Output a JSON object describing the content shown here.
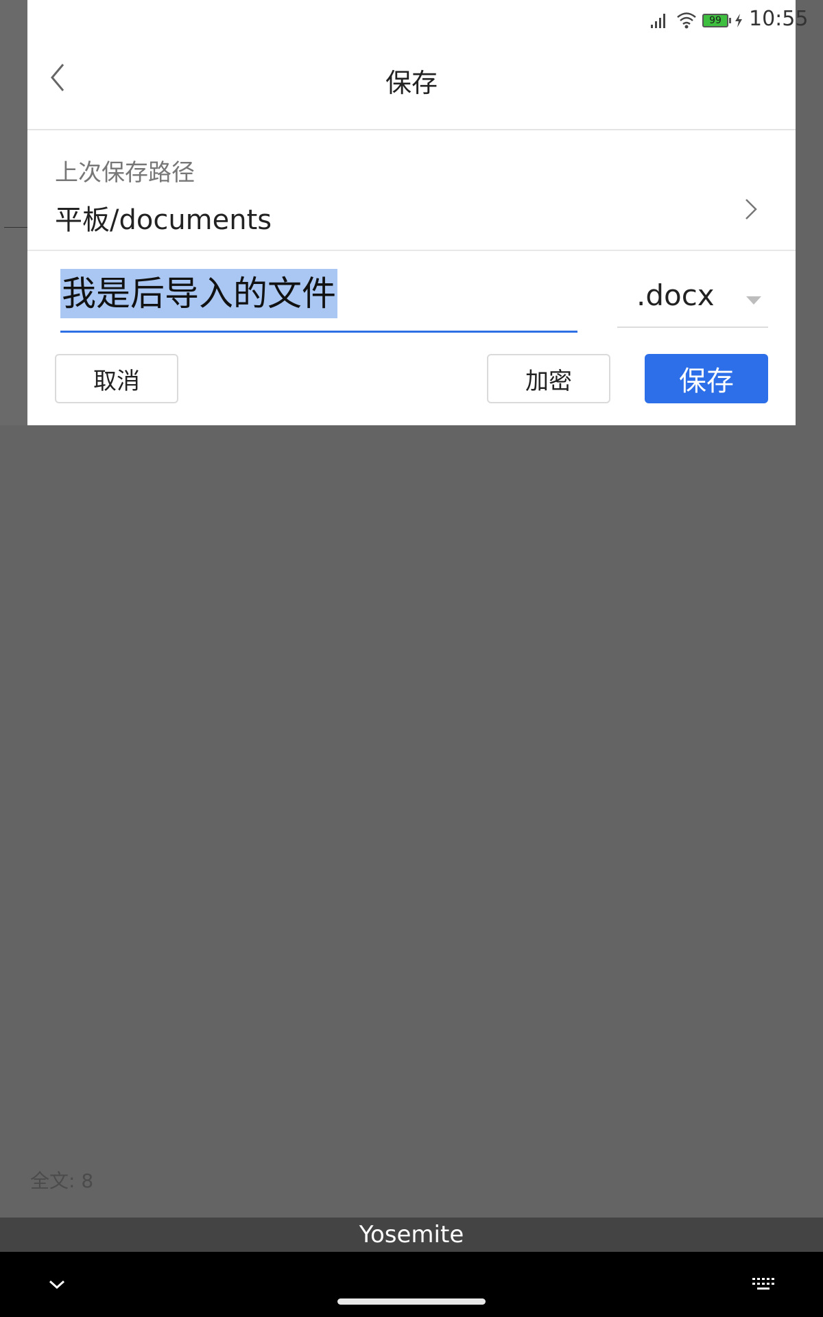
{
  "status_bar": {
    "battery": "99",
    "time": "10:55",
    "icons": [
      "signal-icon",
      "wifi-icon",
      "battery-icon",
      "charging-icon"
    ]
  },
  "dialog": {
    "title": "保存",
    "back_icon": "chevron-left-icon",
    "path": {
      "label": "上次保存路径",
      "value": "平板/documents",
      "icon": "chevron-right-icon"
    },
    "filename": "我是后导入的文件",
    "extension": {
      "selected": ".docx",
      "icon": "dropdown-arrow-icon"
    },
    "buttons": {
      "cancel": "取消",
      "encrypt": "加密",
      "save": "保存"
    }
  },
  "background": {
    "word_count": "全文: 8"
  },
  "keyboard_bar": {
    "label": "Yosemite"
  },
  "nav": {
    "icons": [
      "collapse-keyboard-icon",
      "home-handle",
      "keyboard-icon"
    ]
  },
  "colors": {
    "accent": "#2d6fe8",
    "selection": "#a9c7f2",
    "overlay": "#646464"
  }
}
